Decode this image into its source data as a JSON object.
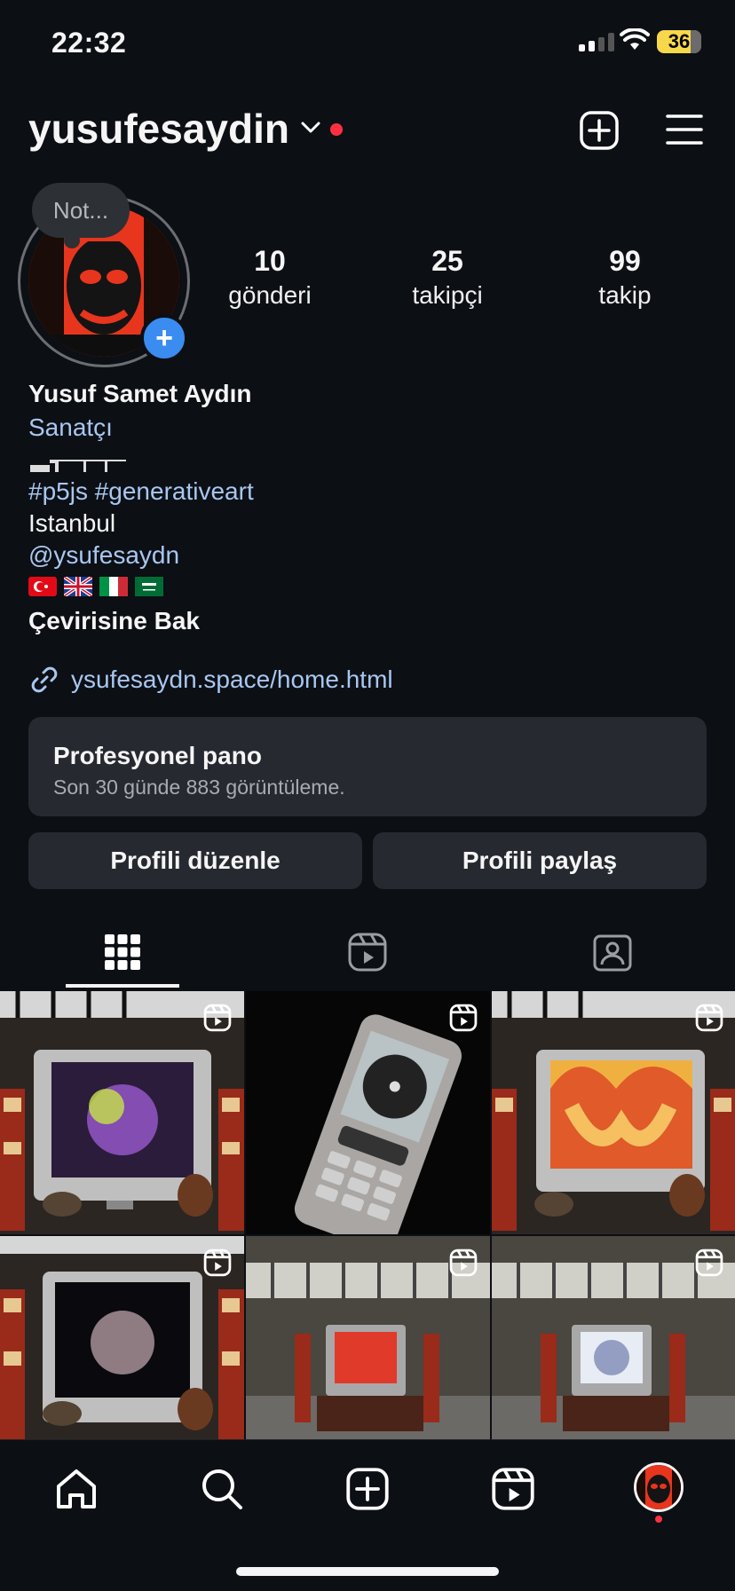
{
  "status_bar": {
    "time": "22:32",
    "battery": "36"
  },
  "header": {
    "username": "yusufesaydin"
  },
  "note": {
    "text": "Not..."
  },
  "stats": [
    {
      "number": "10",
      "label": "gönderi"
    },
    {
      "number": "25",
      "label": "takipçi"
    },
    {
      "number": "99",
      "label": "takip"
    }
  ],
  "bio": {
    "name": "Yusuf Samet Aydın",
    "category": "Sanatçı",
    "tags": "#p5js #generativeart",
    "city": "Istanbul",
    "mention": "@ysufesaydn",
    "translate": "Çevirisine Bak",
    "link": "ysufesaydn.space/home.html"
  },
  "pro_dashboard": {
    "title": "Profesyonel pano",
    "subtitle": "Son 30 günde 883 görüntüleme."
  },
  "buttons": {
    "edit": "Profili düzenle",
    "share": "Profili paylaş"
  },
  "colors": {
    "accent_blue": "#3a8cf0",
    "link": "#a8c7f0",
    "notification": "#ff3040",
    "background": "#0c0f14"
  },
  "icons": {
    "header": [
      "new-post-icon",
      "menu-icon"
    ],
    "tabs": [
      "grid-icon",
      "reels-icon",
      "tagged-icon"
    ],
    "nav": [
      "home-icon",
      "search-icon",
      "create-icon",
      "reels-icon",
      "profile-avatar"
    ]
  }
}
